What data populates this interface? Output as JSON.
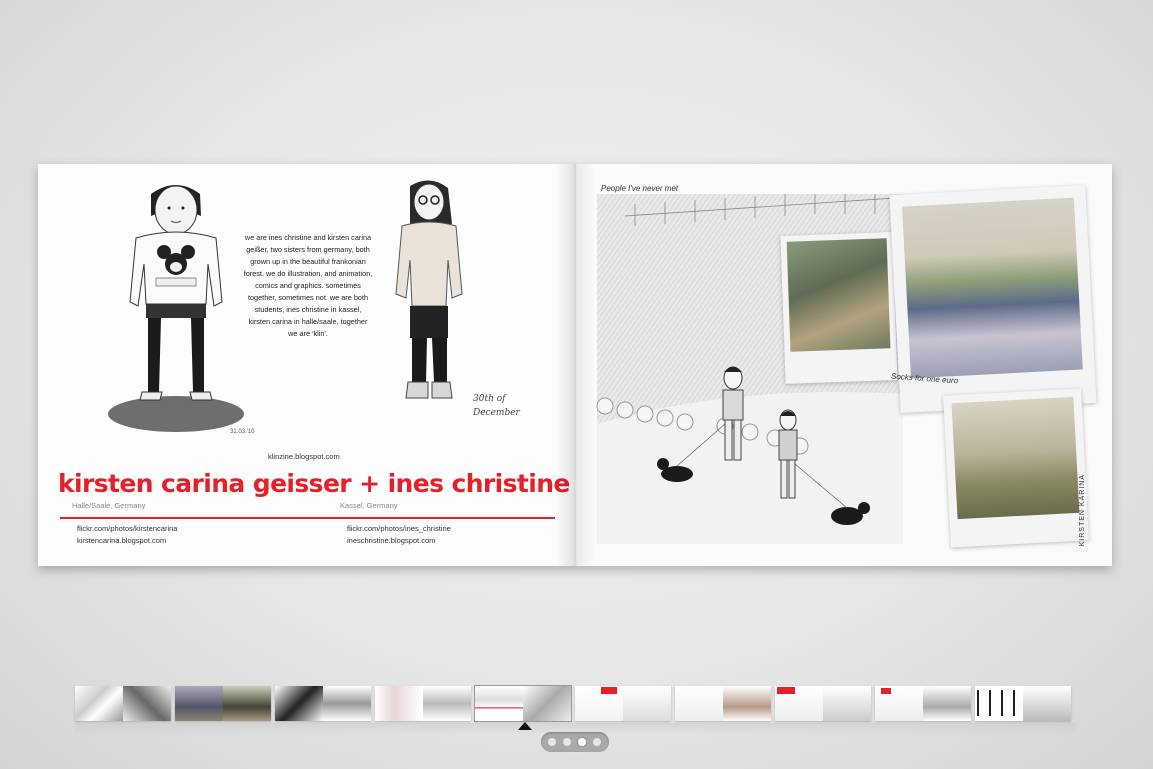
{
  "spread": {
    "left_page": {
      "intro_text": "we are ines christine and kirsten carina geißer, two sisters from germany, both grown up in the beautiful frankonian forest. we do illustration, and animation, comics and graphics. sometimes together, sometimes not. we are both students, ines christine in kassel, kirsten carina in halle/saale. together we are 'klin'.",
      "blog": "klinzine.blogspot.com",
      "title": "kirsten carina geisser + ines christine geisser",
      "location_kirsten": "Halle/Saale, Germany",
      "location_ines": "Kassel, Germany",
      "links_kirsten": [
        "flickr.com/photos/kirstencarina",
        "kirstencarina.blogspot.com"
      ],
      "links_ines": [
        "flickr.com/photos/ines_christine",
        "ineschristine.blogspot.com"
      ],
      "handwritten_date": "30th of December",
      "sketch_date": "31.03.'10",
      "accent_color": "#e4202a"
    },
    "right_page": {
      "caption_top": "People I've never met",
      "caption_socks": "Socks for one euro",
      "signature": "KIRSTEN KARINA"
    }
  },
  "thumbnails": {
    "count": 10,
    "active_index": 4
  },
  "pager": {
    "dots": 4,
    "active_dot": 2
  }
}
